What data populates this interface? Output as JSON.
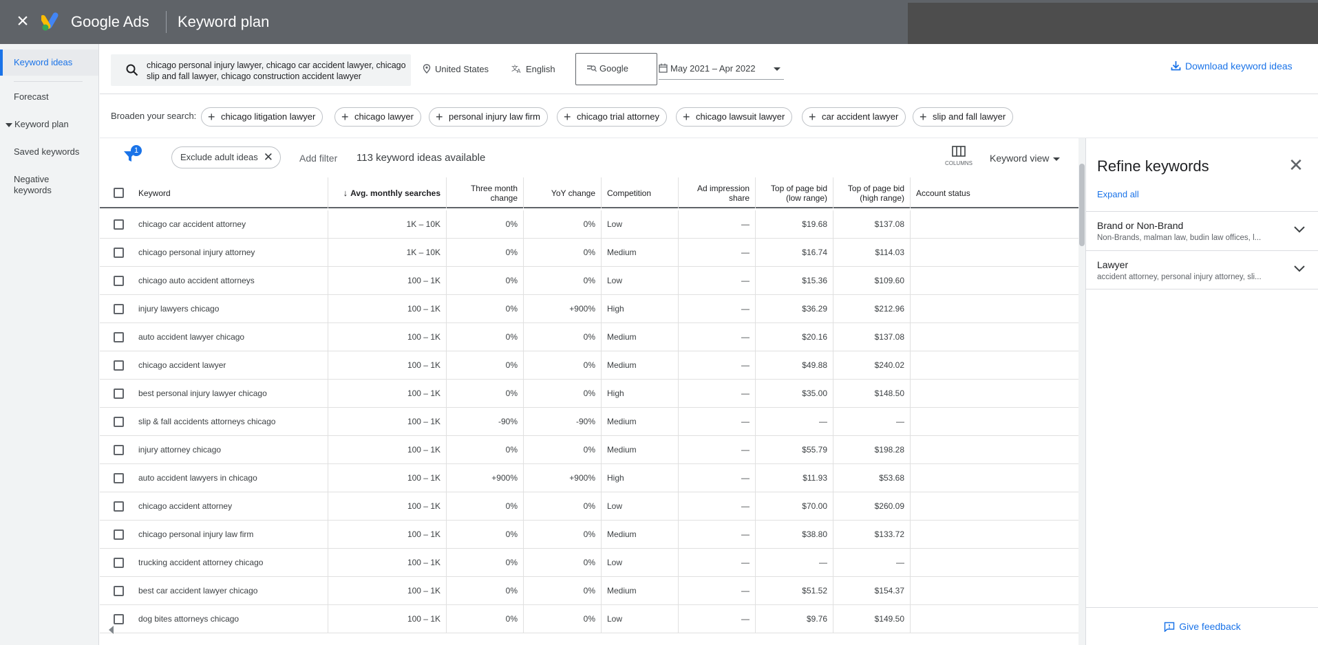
{
  "header": {
    "close_icon": "close-icon",
    "brand": "Google Ads",
    "title": "Keyword plan"
  },
  "sidebar": {
    "items": [
      {
        "label": "Keyword ideas",
        "active": true
      },
      {
        "label": "Forecast"
      },
      {
        "label": "Keyword plan",
        "expanded": true
      },
      {
        "label": "Saved keywords"
      },
      {
        "label": "Negative keywords"
      }
    ]
  },
  "search": {
    "query": "chicago personal injury lawyer, chicago car accident lawyer, chicago slip and fall lawyer, chicago construction accident lawyer",
    "location": "United States",
    "language": "English",
    "network": "Google",
    "date_range": "May 2021 – Apr 2022",
    "download_label": "Download keyword ideas"
  },
  "broaden": {
    "label": "Broaden your search:",
    "chips": [
      "chicago litigation lawyer",
      "chicago lawyer",
      "personal injury law firm",
      "chicago trial attorney",
      "chicago lawsuit lawyer",
      "car accident lawyer",
      "slip and fall lawyer"
    ]
  },
  "toolbar": {
    "filter_count": "1",
    "exclude_chip": "Exclude adult ideas",
    "add_filter": "Add filter",
    "count_text": "113 keyword ideas available",
    "columns_label": "COLUMNS",
    "view_label": "Keyword view"
  },
  "table": {
    "headers": {
      "keyword": "Keyword",
      "avg": "Avg. monthly searches",
      "three_month": "Three month change",
      "yoy": "YoY change",
      "competition": "Competition",
      "ad_share": "Ad impression share",
      "bid_low": "Top of page bid (low range)",
      "bid_high": "Top of page bid (high range)",
      "status": "Account status"
    },
    "rows": [
      {
        "keyword": "chicago car accident attorney",
        "avg": "1K – 10K",
        "three": "0%",
        "yoy": "0%",
        "comp": "Low",
        "share": "—",
        "low": "$19.68",
        "high": "$137.08"
      },
      {
        "keyword": "chicago personal injury attorney",
        "avg": "1K – 10K",
        "three": "0%",
        "yoy": "0%",
        "comp": "Medium",
        "share": "—",
        "low": "$16.74",
        "high": "$114.03"
      },
      {
        "keyword": "chicago auto accident attorneys",
        "avg": "100 – 1K",
        "three": "0%",
        "yoy": "0%",
        "comp": "Low",
        "share": "—",
        "low": "$15.36",
        "high": "$109.60"
      },
      {
        "keyword": "injury lawyers chicago",
        "avg": "100 – 1K",
        "three": "0%",
        "yoy": "+900%",
        "comp": "High",
        "share": "—",
        "low": "$36.29",
        "high": "$212.96"
      },
      {
        "keyword": "auto accident lawyer chicago",
        "avg": "100 – 1K",
        "three": "0%",
        "yoy": "0%",
        "comp": "Medium",
        "share": "—",
        "low": "$20.16",
        "high": "$137.08"
      },
      {
        "keyword": "chicago accident lawyer",
        "avg": "100 – 1K",
        "three": "0%",
        "yoy": "0%",
        "comp": "Medium",
        "share": "—",
        "low": "$49.88",
        "high": "$240.02"
      },
      {
        "keyword": "best personal injury lawyer chicago",
        "avg": "100 – 1K",
        "three": "0%",
        "yoy": "0%",
        "comp": "High",
        "share": "—",
        "low": "$35.00",
        "high": "$148.50"
      },
      {
        "keyword": "slip & fall accidents attorneys chicago",
        "avg": "100 – 1K",
        "three": "-90%",
        "yoy": "-90%",
        "comp": "Medium",
        "share": "—",
        "low": "—",
        "high": "—"
      },
      {
        "keyword": "injury attorney chicago",
        "avg": "100 – 1K",
        "three": "0%",
        "yoy": "0%",
        "comp": "Medium",
        "share": "—",
        "low": "$55.79",
        "high": "$198.28"
      },
      {
        "keyword": "auto accident lawyers in chicago",
        "avg": "100 – 1K",
        "three": "+900%",
        "yoy": "+900%",
        "comp": "High",
        "share": "—",
        "low": "$11.93",
        "high": "$53.68"
      },
      {
        "keyword": "chicago accident attorney",
        "avg": "100 – 1K",
        "three": "0%",
        "yoy": "0%",
        "comp": "Low",
        "share": "—",
        "low": "$70.00",
        "high": "$260.09"
      },
      {
        "keyword": "chicago personal injury law firm",
        "avg": "100 – 1K",
        "three": "0%",
        "yoy": "0%",
        "comp": "Medium",
        "share": "—",
        "low": "$38.80",
        "high": "$133.72"
      },
      {
        "keyword": "trucking accident attorney chicago",
        "avg": "100 – 1K",
        "three": "0%",
        "yoy": "0%",
        "comp": "Low",
        "share": "—",
        "low": "—",
        "high": "—"
      },
      {
        "keyword": "best car accident lawyer chicago",
        "avg": "100 – 1K",
        "three": "0%",
        "yoy": "0%",
        "comp": "Medium",
        "share": "—",
        "low": "$51.52",
        "high": "$154.37"
      },
      {
        "keyword": "dog bites attorneys chicago",
        "avg": "100 – 1K",
        "three": "0%",
        "yoy": "0%",
        "comp": "Low",
        "share": "—",
        "low": "$9.76",
        "high": "$149.50"
      }
    ]
  },
  "refine": {
    "title": "Refine keywords",
    "expand_all": "Expand all",
    "sections": [
      {
        "title": "Brand or Non-Brand",
        "summary": "Non-Brands, malman law, budin law offices, l..."
      },
      {
        "title": "Lawyer",
        "summary": "accident attorney, personal injury attorney, sli..."
      }
    ],
    "feedback": "Give feedback"
  },
  "colors": {
    "accent": "#1a73e8",
    "header_bg": "#5f6368"
  }
}
